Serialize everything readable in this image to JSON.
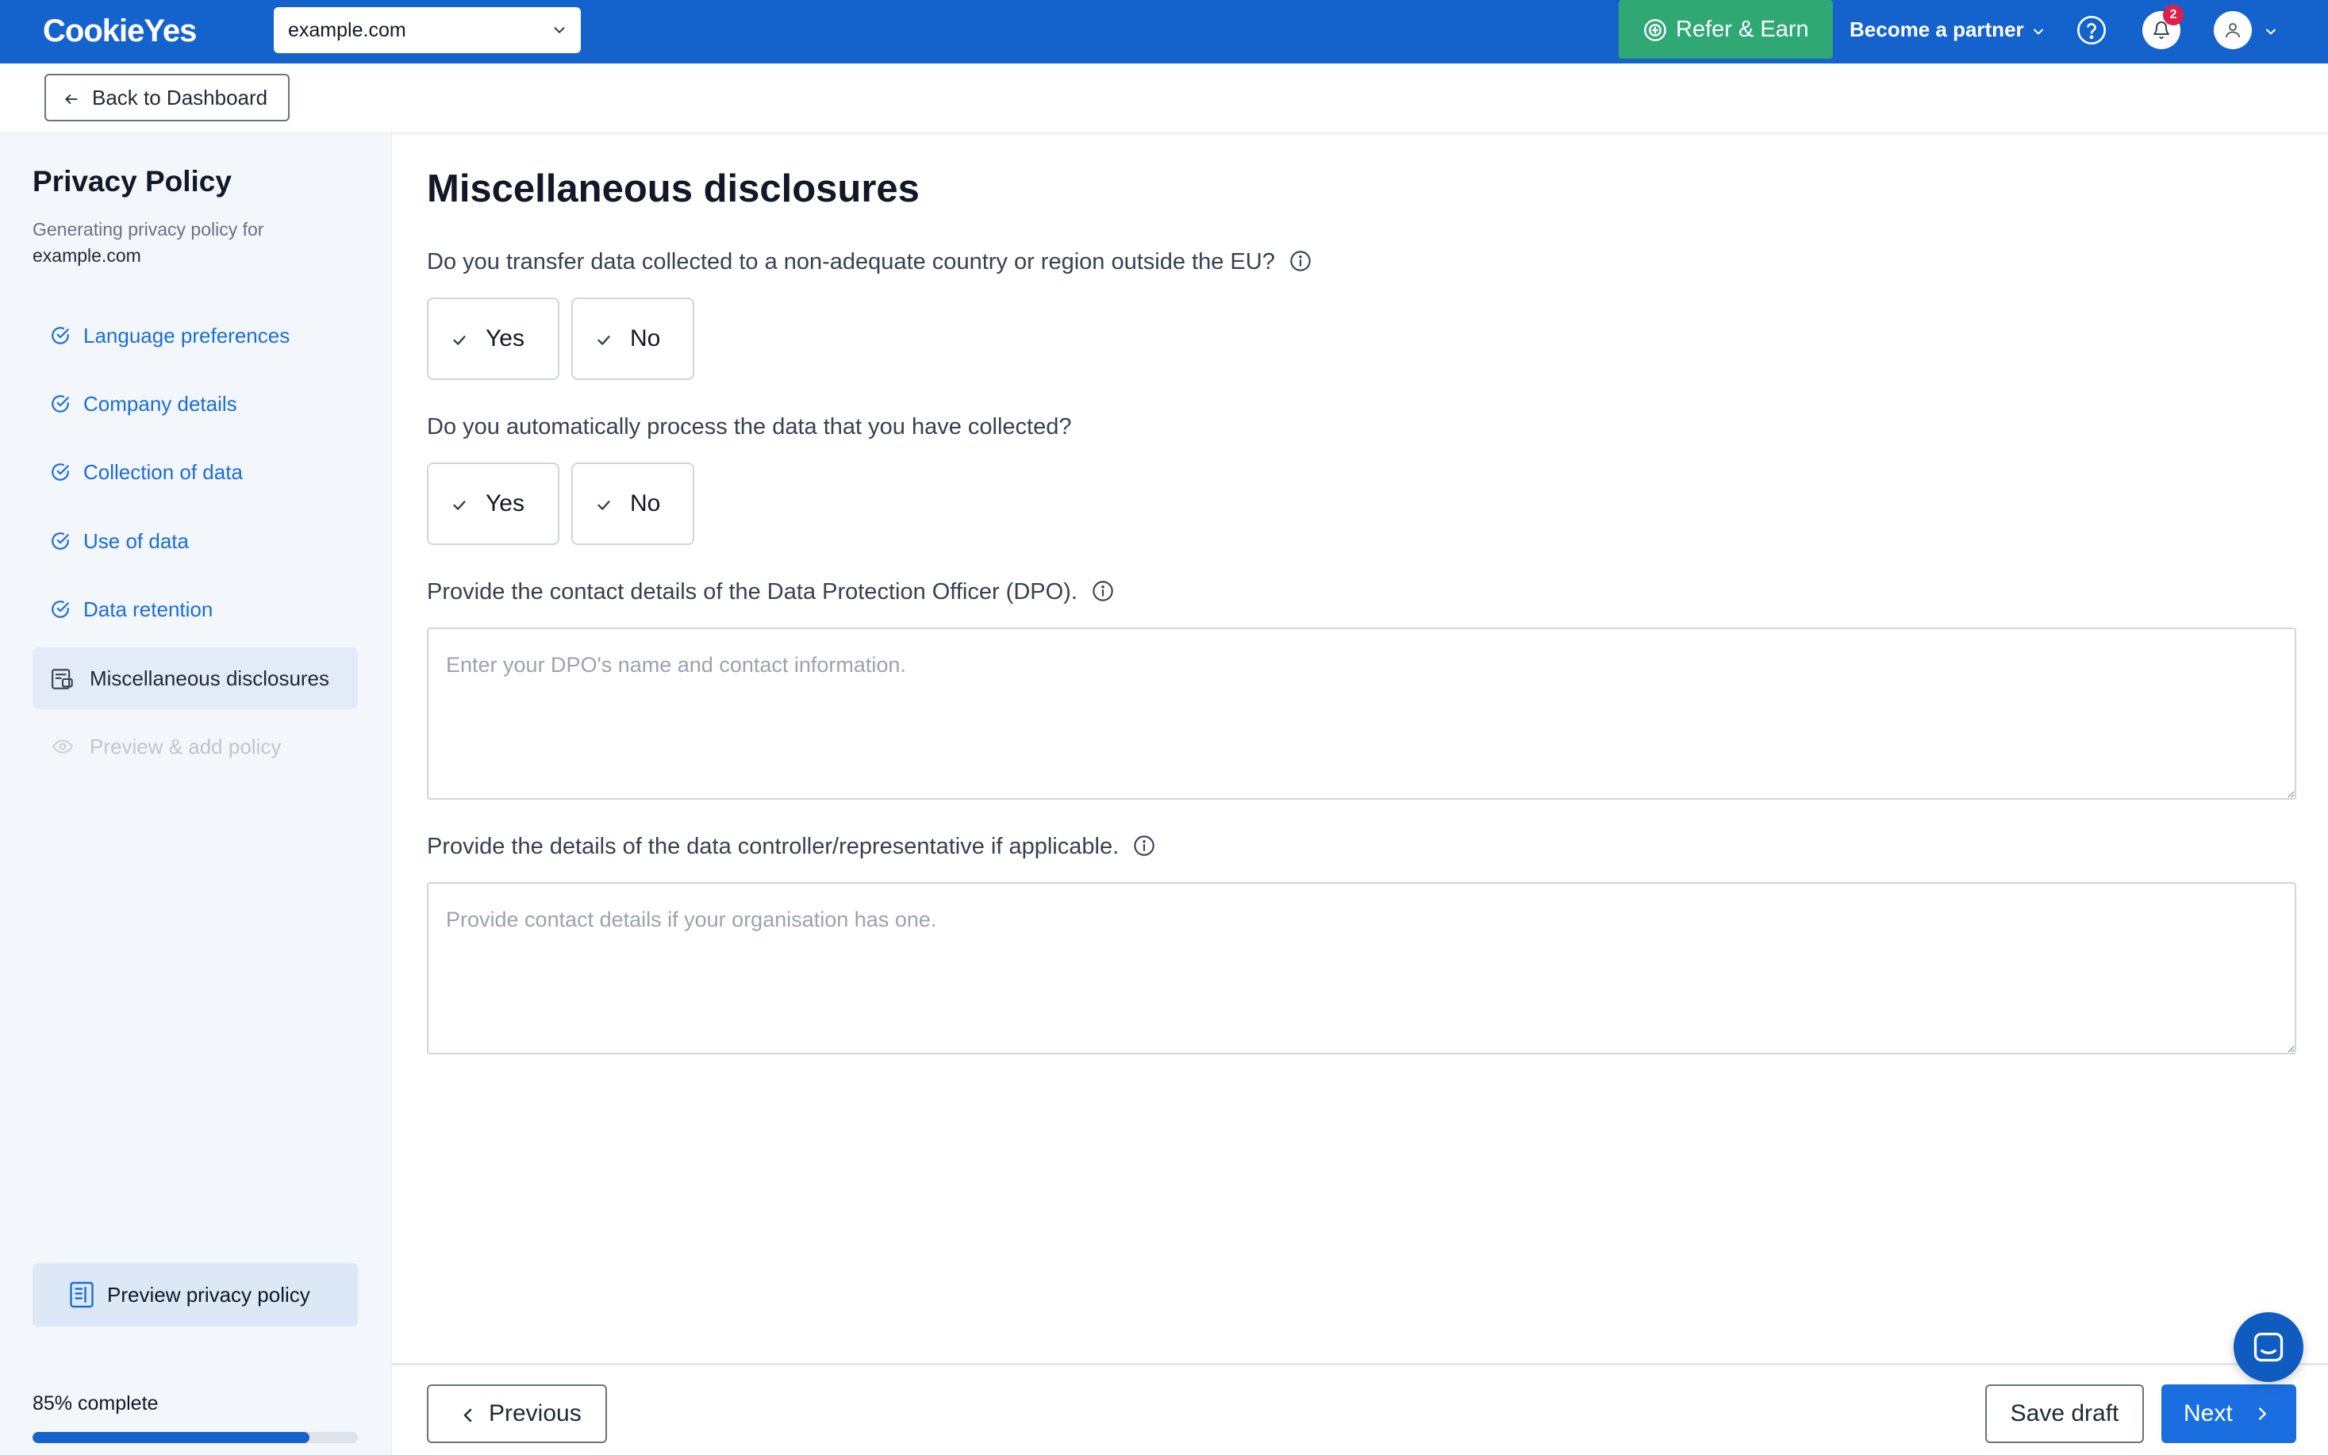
{
  "header": {
    "logo": "CookieYes",
    "domain_select": "example.com",
    "refer_label": "Refer & Earn",
    "partner_label": "Become a partner",
    "notification_count": "2",
    "colors": {
      "bar": "#1463cc",
      "refer": "#2fa874",
      "badge": "#e11d48"
    }
  },
  "subheader": {
    "back_label": "Back to Dashboard"
  },
  "sidebar": {
    "title": "Privacy Policy",
    "subtitle": "Generating privacy policy for",
    "domain": "example.com",
    "items": [
      {
        "label": "Language preferences",
        "icon": "check-circle-icon",
        "state": "done"
      },
      {
        "label": "Company details",
        "icon": "check-circle-icon",
        "state": "done"
      },
      {
        "label": "Collection of data",
        "icon": "check-circle-icon",
        "state": "done"
      },
      {
        "label": "Use of data",
        "icon": "check-circle-icon",
        "state": "done"
      },
      {
        "label": "Data retention",
        "icon": "check-circle-icon",
        "state": "done"
      },
      {
        "label": "Miscellaneous disclosures",
        "icon": "document-icon",
        "state": "active"
      },
      {
        "label": "Preview & add policy",
        "icon": "eye-icon",
        "state": "disabled"
      }
    ],
    "preview_label": "Preview privacy policy",
    "progress_label": "85% complete",
    "progress_percent": 85
  },
  "main": {
    "title": "Miscellaneous disclosures",
    "q1": {
      "text": "Do you transfer data collected to a non-adequate country or region outside the EU?",
      "yes": "Yes",
      "no": "No"
    },
    "q2": {
      "text": "Do you automatically process the data that you have collected?",
      "yes": "Yes",
      "no": "No"
    },
    "q3": {
      "text": "Provide the contact details of the Data Protection Officer (DPO).",
      "placeholder": "Enter your DPO's name and contact information.",
      "value": ""
    },
    "q4": {
      "text": "Provide the details of the data controller/representative if applicable.",
      "placeholder": "Provide contact details if your organisation has one.",
      "value": ""
    }
  },
  "footer": {
    "previous_label": "Previous",
    "save_label": "Save draft",
    "next_label": "Next"
  }
}
